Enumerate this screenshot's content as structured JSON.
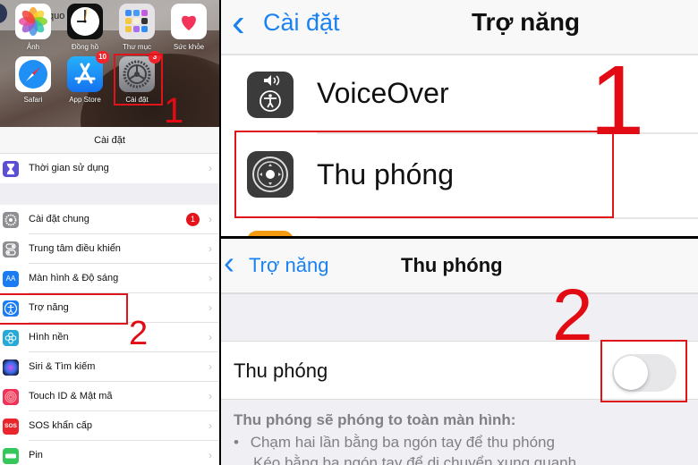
{
  "home_screen": {
    "partial_text": "quo",
    "apps": [
      {
        "label": "Ảnh",
        "icon": "photos-icon"
      },
      {
        "label": "Đồng hồ",
        "icon": "clock-icon"
      },
      {
        "label": "Thư mục",
        "icon": "folder-icon"
      },
      {
        "label": "Sức khỏe",
        "icon": "health-icon"
      },
      {
        "label": "Safari",
        "icon": "safari-icon"
      },
      {
        "label": "App Store",
        "icon": "app-store-icon",
        "badge": "10"
      },
      {
        "label": "Cài đặt",
        "icon": "settings-icon",
        "badge": "3"
      }
    ],
    "step_label": "1"
  },
  "settings": {
    "header_title": "Cài đặt",
    "group1": [
      {
        "label": "Thời gian sử dụng",
        "icon": "hourglass-icon",
        "color": "#5b4fd6"
      }
    ],
    "group2": [
      {
        "label": "Cài đặt chung",
        "icon": "gear-icon",
        "color": "#8e8e93",
        "badge": "1"
      },
      {
        "label": "Trung tâm điều khiển",
        "icon": "toggles-icon",
        "color": "#8e8e93"
      },
      {
        "label": "Màn hình & Độ sáng",
        "icon": "text-size-icon",
        "color": "#1a7cf2",
        "glyph": "AA"
      },
      {
        "label": "Trợ năng",
        "icon": "accessibility-icon",
        "color": "#1a7cf2"
      },
      {
        "label": "Hình nền",
        "icon": "wallpaper-icon",
        "color": "#27a9d8"
      },
      {
        "label": "Siri & Tìm kiếm",
        "icon": "siri-icon",
        "color": "#1b1b3a"
      },
      {
        "label": "Touch ID & Mật mã",
        "icon": "fingerprint-icon",
        "color": "#f0325a"
      },
      {
        "label": "SOS khẩn cấp",
        "icon": "sos-icon",
        "color": "#e8262b",
        "glyph": "SOS"
      },
      {
        "label": "Pin",
        "icon": "battery-icon",
        "color": "#35c759"
      }
    ],
    "step_label": "2"
  },
  "accessibility": {
    "back_label": "Cài đặt",
    "title": "Trợ năng",
    "items": [
      {
        "label": "VoiceOver",
        "icon": "voiceover-icon"
      },
      {
        "label": "Thu phóng",
        "icon": "zoom-icon"
      }
    ],
    "step_label": "1"
  },
  "zoom_screen": {
    "back_label": "Trợ năng",
    "title": "Thu phóng",
    "toggle_label": "Thu phóng",
    "toggle_on": false,
    "footer_title": "Thu phóng sẽ phóng to toàn màn hình:",
    "footer_items": [
      "Chạm hai lần bằng ba ngón tay để thu phóng",
      "Kéo bằng ba ngón tay để di chuyển xung quanh"
    ],
    "bullet": "•",
    "step_label": "2"
  },
  "glyphs": {
    "chevron_right": "›",
    "chevron_left": "‹"
  },
  "colors": {
    "accent": "#1a82f0",
    "annotation_red": "#e30b13",
    "badge_red": "#f2232a"
  }
}
